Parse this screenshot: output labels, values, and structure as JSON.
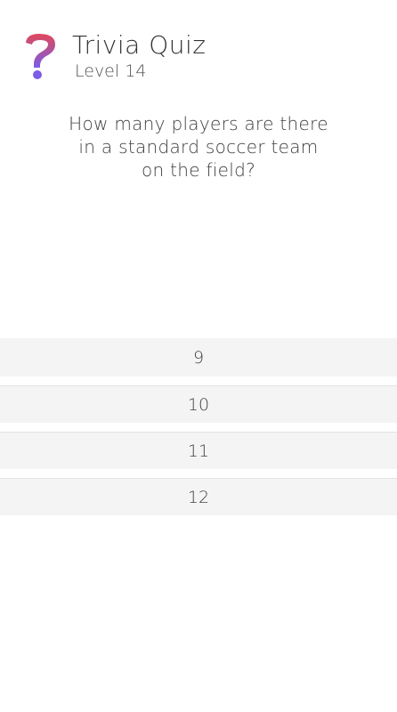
{
  "header": {
    "logo_icon": "question-mark-icon",
    "title": "Trivia Quiz",
    "level": "Level 14"
  },
  "question": {
    "text": "How many players are there in a standard soccer team on the field?"
  },
  "answers": [
    {
      "label": "9"
    },
    {
      "label": "10"
    },
    {
      "label": "11"
    },
    {
      "label": "12"
    }
  ],
  "colors": {
    "logo_top": "#e0485a",
    "logo_bottom": "#7b5ce6",
    "answer_bg": "#f4f4f4"
  }
}
